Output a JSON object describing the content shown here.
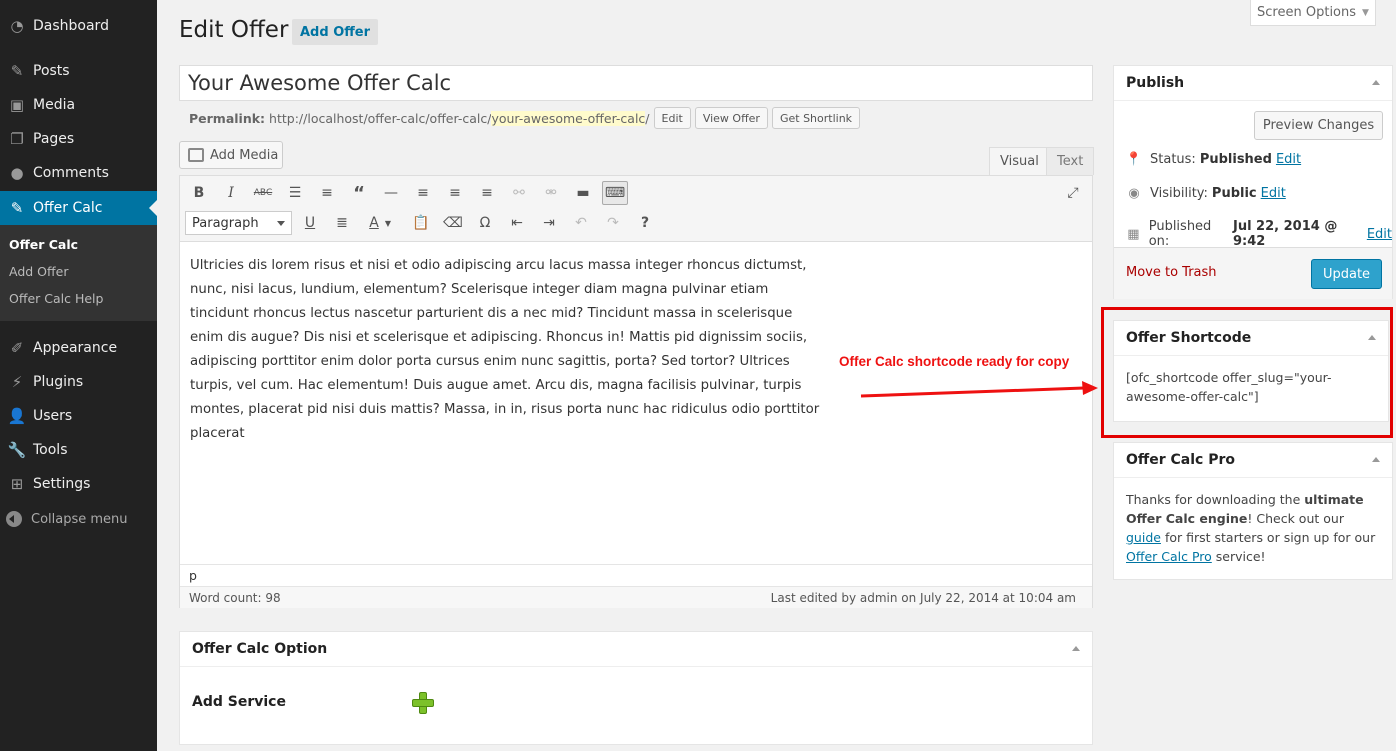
{
  "menu": {
    "items": [
      {
        "label": "Dashboard",
        "icon": "dashboard-icon"
      },
      {
        "label": "Posts",
        "icon": "pin-icon"
      },
      {
        "label": "Media",
        "icon": "media-icon"
      },
      {
        "label": "Pages",
        "icon": "pages-icon"
      },
      {
        "label": "Comments",
        "icon": "comments-icon"
      },
      {
        "label": "Offer Calc",
        "icon": "pin-icon"
      },
      {
        "label": "Appearance",
        "icon": "brush-icon"
      },
      {
        "label": "Plugins",
        "icon": "plugin-icon"
      },
      {
        "label": "Users",
        "icon": "user-icon"
      },
      {
        "label": "Tools",
        "icon": "wrench-icon"
      },
      {
        "label": "Settings",
        "icon": "settings-icon"
      }
    ],
    "submenu": [
      "Offer Calc",
      "Add Offer",
      "Offer Calc Help"
    ],
    "collapse": "Collapse menu"
  },
  "header": {
    "title": "Edit Offer",
    "add_new": "Add Offer",
    "screen_options": "Screen Options"
  },
  "post": {
    "title": "Your Awesome Offer Calc",
    "permalink_label": "Permalink:",
    "permalink_base": "http://localhost/offer-calc/offer-calc/",
    "permalink_slug": "your-awesome-offer-calc",
    "permalink_end": "/",
    "edit_btn": "Edit",
    "view_btn": "View Offer",
    "shortlink_btn": "Get Shortlink"
  },
  "editor": {
    "add_media": "Add Media",
    "tab_visual": "Visual",
    "tab_text": "Text",
    "format": "Paragraph",
    "content": "Ultricies dis lorem risus et nisi et odio adipiscing arcu lacus massa integer rhoncus dictumst, nunc, nisi lacus, lundium, elementum? Scelerisque integer diam magna pulvinar etiam tincidunt rhoncus lectus nascetur parturient dis a nec mid? Tincidunt massa in scelerisque enim dis augue? Dis nisi et scelerisque et adipiscing. Rhoncus in! Mattis pid dignissim sociis, adipiscing porttitor enim dolor porta cursus enim nunc sagittis, porta? Sed tortor? Ultrices turpis, vel cum. Hac elementum! Duis augue amet. Arcu dis, magna facilisis pulvinar, turpis montes, placerat pid nisi duis mattis? Massa, in in, risus porta nunc hac ridiculus odio porttitor placerat",
    "path": "p",
    "word_count": "Word count: 98",
    "last_edited": "Last edited by admin on July 22, 2014 at 10:04 am"
  },
  "annotation": "Offer Calc shortcode ready for copy",
  "publish": {
    "title": "Publish",
    "preview": "Preview Changes",
    "status_label": "Status:",
    "status_value": "Published",
    "visibility_label": "Visibility:",
    "visibility_value": "Public",
    "published_label": "Published on:",
    "published_value": "Jul 22, 2014 @ 9:42",
    "edit": "Edit",
    "trash": "Move to Trash",
    "update": "Update"
  },
  "shortcode": {
    "title": "Offer Shortcode",
    "value": "[ofc_shortcode offer_slug=\"your-awesome-offer-calc\"]"
  },
  "pro": {
    "title": "Offer Calc Pro",
    "t1": "Thanks for downloading the ",
    "t2": "ultimate Offer Calc engine",
    "t3": "! Check out our ",
    "guide": "guide",
    "t4": " for first starters or sign up for our ",
    "pro_link": "Offer Calc Pro",
    "t5": " service!"
  },
  "option": {
    "title": "Offer Calc Option",
    "add_service": "Add Service"
  },
  "colors": {
    "menu_bg": "#222222",
    "accent": "#0074a2",
    "update": "#2ea2cc",
    "annotation": "#e20000"
  }
}
